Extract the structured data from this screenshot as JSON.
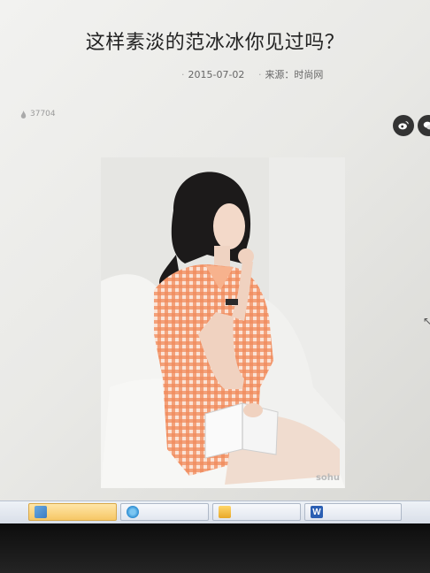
{
  "article": {
    "title": "这样素淡的范冰冰你见过吗？",
    "date": "2015-07-02",
    "source": "来源：时尚网",
    "views": "37704"
  },
  "photo": {
    "watermark": "sohu"
  },
  "share": {
    "icons": [
      "weibo-icon",
      "wechat-icon"
    ]
  },
  "taskbar": {
    "items": [
      {
        "icon": "photo-viewer-icon",
        "active": true
      },
      {
        "icon": "browser-icon",
        "active": false
      },
      {
        "icon": "folder-icon",
        "active": false
      },
      {
        "icon": "word-icon",
        "active": false
      }
    ]
  },
  "colors": {
    "page_bg": "#ececea",
    "taskbar_active": "#f6c766",
    "title_text": "#222222",
    "share_icon_bg": "#333333"
  }
}
